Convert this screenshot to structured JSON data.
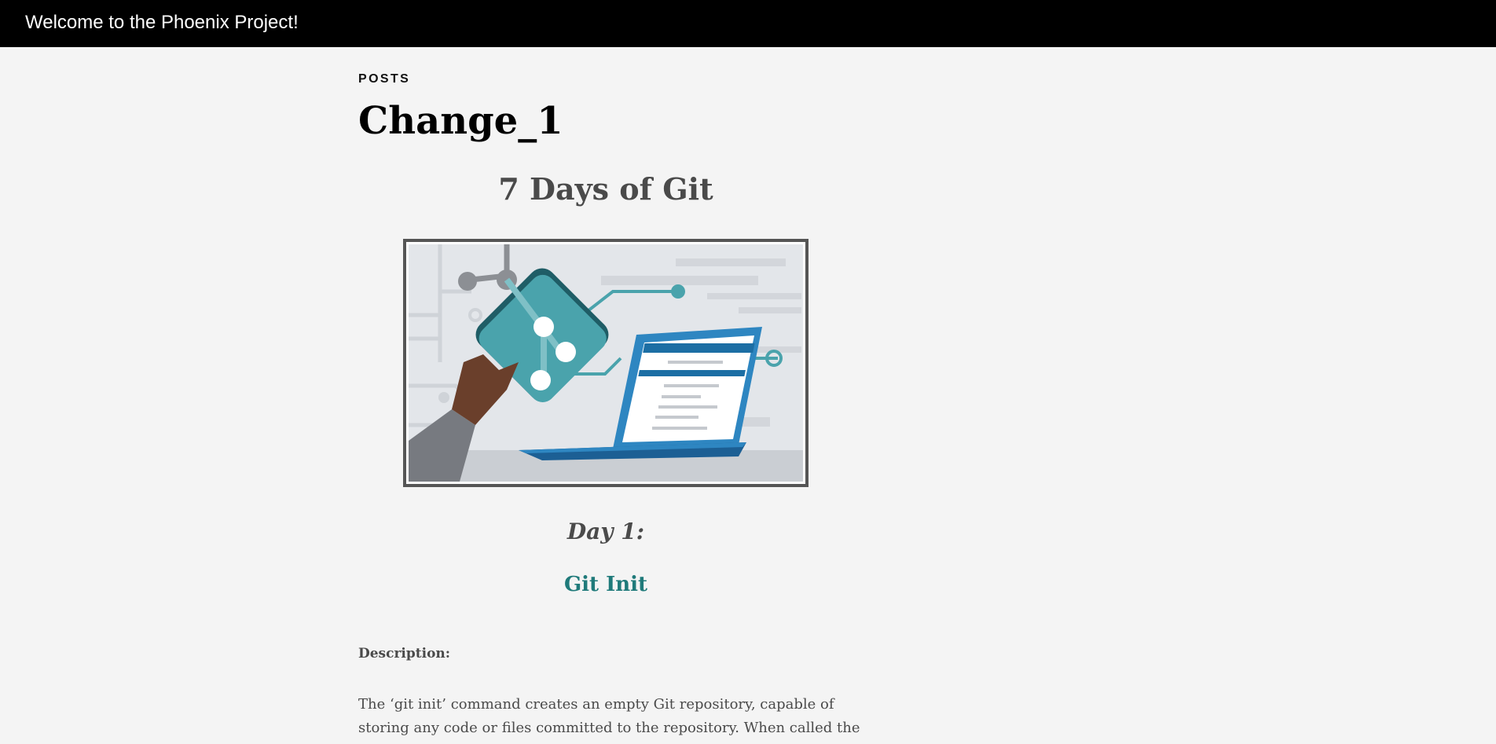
{
  "header": {
    "title": "Welcome to the Phoenix Project!"
  },
  "post": {
    "category": "POSTS",
    "title": "Change_1",
    "heading": "7 Days of Git",
    "hero_image_icon": "git-laptop-illustration",
    "day_heading": "Day 1:",
    "day_subheading": "Git Init",
    "description_label": "Description:",
    "description_lines": [
      "The ‘git init’ command creates an empty Git repository, capable of",
      "storing any code or files committed to the repository. When called the"
    ]
  },
  "colors": {
    "topbar_bg": "#000000",
    "page_bg": "#f4f4f4",
    "accent_teal": "#1f7a7a",
    "text_gray": "#4a4a4a"
  }
}
